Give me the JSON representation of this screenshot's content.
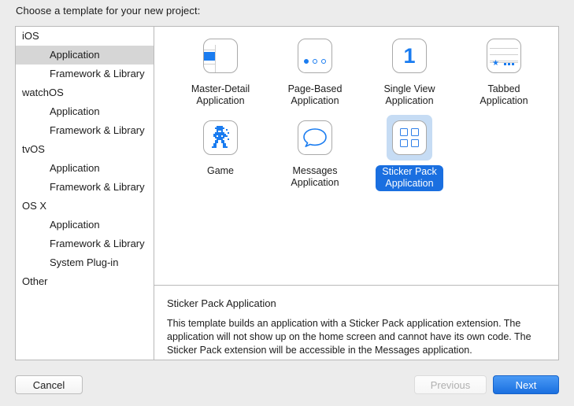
{
  "dialog": {
    "title": "Choose a template for your new project:"
  },
  "sidebar": {
    "items": [
      {
        "label": "iOS",
        "level": "group",
        "selected": false
      },
      {
        "label": "Application",
        "level": "child",
        "selected": true
      },
      {
        "label": "Framework & Library",
        "level": "child",
        "selected": false
      },
      {
        "label": "watchOS",
        "level": "group",
        "selected": false
      },
      {
        "label": "Application",
        "level": "child",
        "selected": false
      },
      {
        "label": "Framework & Library",
        "level": "child",
        "selected": false
      },
      {
        "label": "tvOS",
        "level": "group",
        "selected": false
      },
      {
        "label": "Application",
        "level": "child",
        "selected": false
      },
      {
        "label": "Framework & Library",
        "level": "child",
        "selected": false
      },
      {
        "label": "OS X",
        "level": "group",
        "selected": false
      },
      {
        "label": "Application",
        "level": "child",
        "selected": false
      },
      {
        "label": "Framework & Library",
        "level": "child",
        "selected": false
      },
      {
        "label": "System Plug-in",
        "level": "child",
        "selected": false
      },
      {
        "label": "Other",
        "level": "group",
        "selected": false
      }
    ]
  },
  "templates": {
    "row1": [
      {
        "label": "Master-Detail\nApplication",
        "line1": "Master-Detail",
        "line2": "Application",
        "icon": "master-detail-icon",
        "selected": false
      },
      {
        "label": "Page-Based\nApplication",
        "line1": "Page-Based",
        "line2": "Application",
        "icon": "page-based-icon",
        "selected": false
      },
      {
        "label": "Single View\nApplication",
        "line1": "Single View",
        "line2": "Application",
        "icon": "single-view-icon",
        "selected": false
      },
      {
        "label": "Tabbed\nApplication",
        "line1": "Tabbed",
        "line2": "Application",
        "icon": "tabbed-icon",
        "selected": false
      }
    ],
    "row2": [
      {
        "label": "Game",
        "line1": "Game",
        "line2": "",
        "icon": "game-icon",
        "selected": false
      },
      {
        "label": "Messages\nApplication",
        "line1": "Messages",
        "line2": "Application",
        "icon": "messages-icon",
        "selected": false
      },
      {
        "label": "Sticker Pack\nApplication",
        "line1": "Sticker Pack",
        "line2": "Application",
        "icon": "sticker-pack-icon",
        "selected": true
      }
    ]
  },
  "description": {
    "title": "Sticker Pack Application",
    "body": "This template builds an application with a Sticker Pack application extension. The application will not show up on the home screen and cannot have its own code. The Sticker Pack extension will be accessible in the Messages application."
  },
  "footer": {
    "cancel_label": "Cancel",
    "previous_label": "Previous",
    "previous_disabled": true,
    "next_label": "Next"
  },
  "colors": {
    "accent_blue": "#1a6fe0",
    "icon_blue": "#1a7cf0",
    "selection_bg": "#c6dcf4",
    "sidebar_selection": "#d6d6d6",
    "window_bg": "#ececec"
  }
}
